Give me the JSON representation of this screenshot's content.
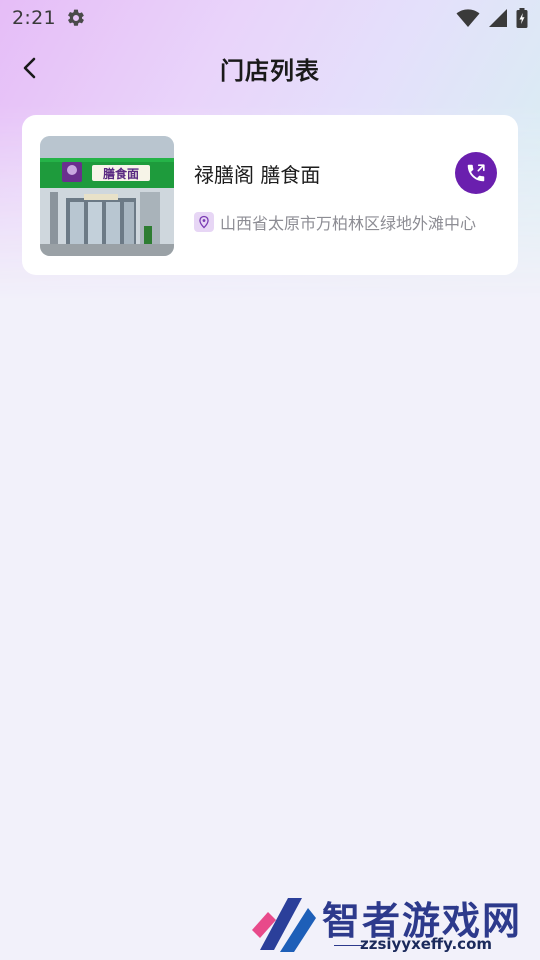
{
  "status_bar": {
    "time": "2:21"
  },
  "header": {
    "title": "门店列表"
  },
  "stores": [
    {
      "name": "禄膳阁 膳食面",
      "address": "山西省太原市万柏林区绿地外滩中心",
      "sign_text": "膳食面"
    }
  ],
  "watermark": {
    "title": "智者游戏网",
    "url": "zzsiyyxeffy.com"
  },
  "colors": {
    "accent": "#6a1fae",
    "background": "#f2f1fa",
    "card": "#ffffff",
    "address_text": "#8d8d94",
    "sign_green": "#1e9b3c"
  },
  "icons": {
    "settings": "gear-icon",
    "wifi": "wifi-icon",
    "signal": "signal-icon",
    "battery": "battery-icon",
    "back": "back-arrow-icon",
    "call": "phone-call-icon",
    "location": "location-pin-icon"
  }
}
